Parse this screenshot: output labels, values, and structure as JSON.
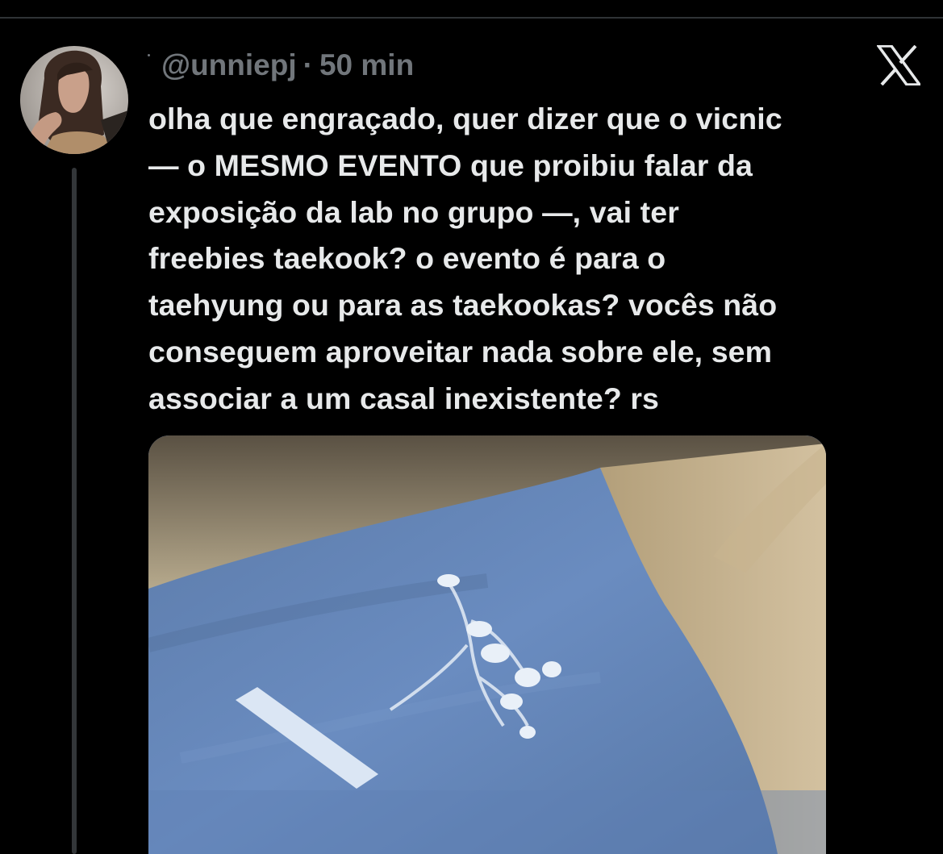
{
  "tweet": {
    "handle": "@unniepj",
    "separator": "·",
    "time": "50 min",
    "text": "olha que engraçado, quer dizer que o vicnic\n— o MESMO EVENTO que proibiu falar da\nexposição da lab no grupo —, vai ter\nfreebies taekook? o evento é para o\ntaehyung ou para as taekookas? vocês não\nconseguem aproveitar nada sobre ele, sem\nassociar a um casal inexistente? rs"
  },
  "icons": {
    "brand": "x-logo-icon",
    "avatar": "profile-photo",
    "media": "photo-of-box-with-blue-fabric"
  },
  "colors": {
    "background": "#000000",
    "text_primary": "#e7e9ea",
    "text_secondary": "#71767b",
    "divider": "#2f3336",
    "thread_line": "#333639"
  }
}
